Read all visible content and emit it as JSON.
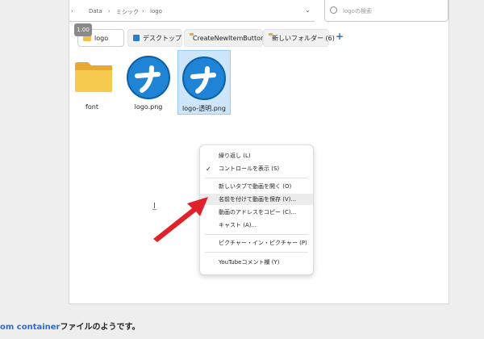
{
  "address": {
    "crumbs": [
      "›",
      "Data",
      "›",
      "ミシック",
      "›",
      "logo"
    ],
    "dropdown": "⌄"
  },
  "search": {
    "placeholder": "logoの検索"
  },
  "zoom_badge": "1.00",
  "tabs": [
    {
      "label": "logo",
      "icon": "folder-icon",
      "active": true
    },
    {
      "label": "デスクトップ",
      "icon": "desktop-icon",
      "active": false
    },
    {
      "label": "CreateNewItemButtons",
      "icon": "folder-icon",
      "active": false
    },
    {
      "label": "新しいフォルダー (6)",
      "icon": "folder-icon",
      "active": false
    }
  ],
  "tab_add": "+",
  "files": [
    {
      "name": "font",
      "type": "folder",
      "selected": false
    },
    {
      "name": "logo.png",
      "type": "image",
      "selected": false
    },
    {
      "name": "logo-透明.png",
      "type": "image",
      "selected": true
    }
  ],
  "context_menu": {
    "items": [
      {
        "label": "繰り返し (L)",
        "checked": false,
        "highlighted": false
      },
      {
        "label": "コントロールを表示 (S)",
        "checked": true,
        "highlighted": false
      },
      {
        "label": "新しいタブで動画を開く (O)",
        "checked": false,
        "highlighted": false
      },
      {
        "label": "名前を付けて動画を保存 (V)...",
        "checked": false,
        "highlighted": true
      },
      {
        "label": "動画のアドレスをコピー (C)...",
        "checked": false,
        "highlighted": false
      },
      {
        "label": "キャスト (A)...",
        "checked": false,
        "highlighted": false
      },
      {
        "label": "ピクチャー・イン・ピクチャー (P)",
        "checked": false,
        "highlighted": false
      },
      {
        "label": "YouTubeコメント欄 (Y)",
        "checked": false,
        "highlighted": false
      }
    ],
    "check_glyph": "✓"
  },
  "caption": {
    "link_part": "om container",
    "rest": "ファイルのようです。"
  },
  "colors": {
    "accent": "#2b6cd4",
    "arrow": "#e0212a",
    "selection": "#cde6fb",
    "folder": "#f4c04a"
  }
}
